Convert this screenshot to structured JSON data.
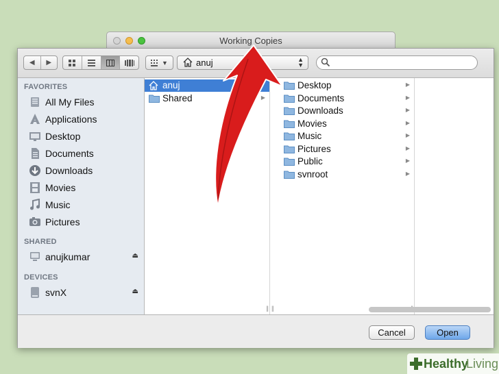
{
  "window": {
    "title": "Working Copies"
  },
  "toolbar": {
    "path_label": "anuj",
    "search_placeholder": ""
  },
  "sidebar": {
    "favorites_heading": "FAVORITES",
    "favorites": [
      {
        "label": "All My Files",
        "icon": "all-files-icon"
      },
      {
        "label": "Applications",
        "icon": "applications-icon"
      },
      {
        "label": "Desktop",
        "icon": "desktop-icon"
      },
      {
        "label": "Documents",
        "icon": "documents-icon"
      },
      {
        "label": "Downloads",
        "icon": "downloads-icon"
      },
      {
        "label": "Movies",
        "icon": "movies-icon"
      },
      {
        "label": "Music",
        "icon": "music-icon"
      },
      {
        "label": "Pictures",
        "icon": "pictures-icon"
      }
    ],
    "shared_heading": "SHARED",
    "shared": [
      {
        "label": "anujkumar",
        "icon": "computer-icon"
      }
    ],
    "devices_heading": "DEVICES",
    "devices": [
      {
        "label": "svnX",
        "icon": "disk-icon"
      }
    ]
  },
  "columns": {
    "col1": [
      {
        "label": "anuj",
        "selected": true,
        "has_children": false
      },
      {
        "label": "Shared",
        "selected": false,
        "has_children": true
      }
    ],
    "col2": [
      {
        "label": "Desktop"
      },
      {
        "label": "Documents"
      },
      {
        "label": "Downloads"
      },
      {
        "label": "Movies"
      },
      {
        "label": "Music"
      },
      {
        "label": "Pictures"
      },
      {
        "label": "Public"
      },
      {
        "label": "svnroot"
      }
    ]
  },
  "buttons": {
    "cancel": "Cancel",
    "open": "Open"
  },
  "watermark": {
    "part1": "Healthy",
    "part2": "Living"
  },
  "colors": {
    "selection": "#3f7fd5",
    "annotation_arrow": "#d91c1c",
    "background": "#c9ddb9"
  }
}
